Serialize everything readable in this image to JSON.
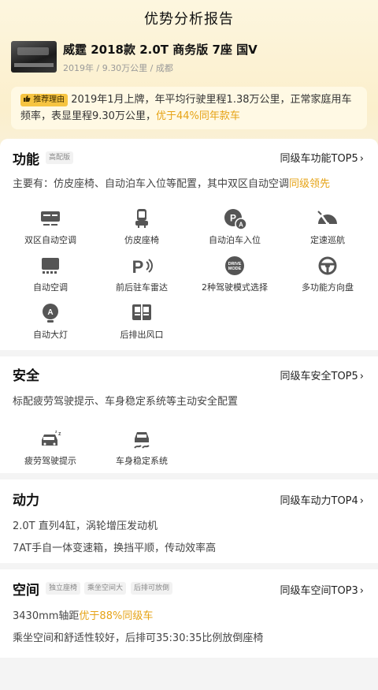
{
  "page": {
    "title": "优势分析报告"
  },
  "car": {
    "name": "威霆 2018款 2.0T 商务版 7座 国V",
    "meta": "2019年 / 9.30万公里 / 成都"
  },
  "recommendation": {
    "tag": "推荐理由",
    "text": "2019年1月上牌，年平均行驶里程1.38万公里，正常家庭用车频率，表显里程9.30万公里，",
    "highlight": "优于44%同年款车"
  },
  "function": {
    "title": "功能",
    "badge": "高配版",
    "link": "同级车功能TOP5",
    "desc": "主要有：仿皮座椅、自动泊车入位等配置，其中双区自动空调",
    "desc_highlight": "同级领先",
    "items": [
      {
        "label": "双区自动空调",
        "icon": "dual-zone-ac-icon"
      },
      {
        "label": "仿皮座椅",
        "icon": "leather-seat-icon"
      },
      {
        "label": "自动泊车入位",
        "icon": "auto-parking-icon"
      },
      {
        "label": "定速巡航",
        "icon": "cruise-control-icon"
      },
      {
        "label": "自动空调",
        "icon": "auto-ac-icon"
      },
      {
        "label": "前后驻车雷达",
        "icon": "parking-radar-icon"
      },
      {
        "label": "2种驾驶模式选择",
        "icon": "drive-mode-icon"
      },
      {
        "label": "多功能方向盘",
        "icon": "steering-wheel-icon"
      },
      {
        "label": "自动大灯",
        "icon": "auto-headlight-icon"
      },
      {
        "label": "后排出风口",
        "icon": "rear-vent-icon"
      }
    ],
    "drive_mode_text": "DRIVE MODE"
  },
  "safety": {
    "title": "安全",
    "link": "同级车安全TOP5",
    "desc": "标配疲劳驾驶提示、车身稳定系统等主动安全配置",
    "items": [
      {
        "label": "疲劳驾驶提示",
        "icon": "fatigue-alert-icon"
      },
      {
        "label": "车身稳定系统",
        "icon": "stability-control-icon"
      }
    ]
  },
  "power": {
    "title": "动力",
    "link": "同级车动力TOP4",
    "line1": "2.0T 直列4缸，涡轮增压发动机",
    "line2": "7AT手自一体变速箱，换挡平顺，传动效率高"
  },
  "space": {
    "title": "空间",
    "tags": [
      "独立座椅",
      "乘坐空间大",
      "后排可放倒"
    ],
    "link": "同级车空间TOP3",
    "line1": "3430mm轴距",
    "line1_highlight": "优于88%同级车",
    "line2": "乘坐空间和舒适性较好，后排可35:30:35比例放倒座椅"
  },
  "colors": {
    "accent": "#e6a316",
    "tag_bg": "#f6c441"
  }
}
